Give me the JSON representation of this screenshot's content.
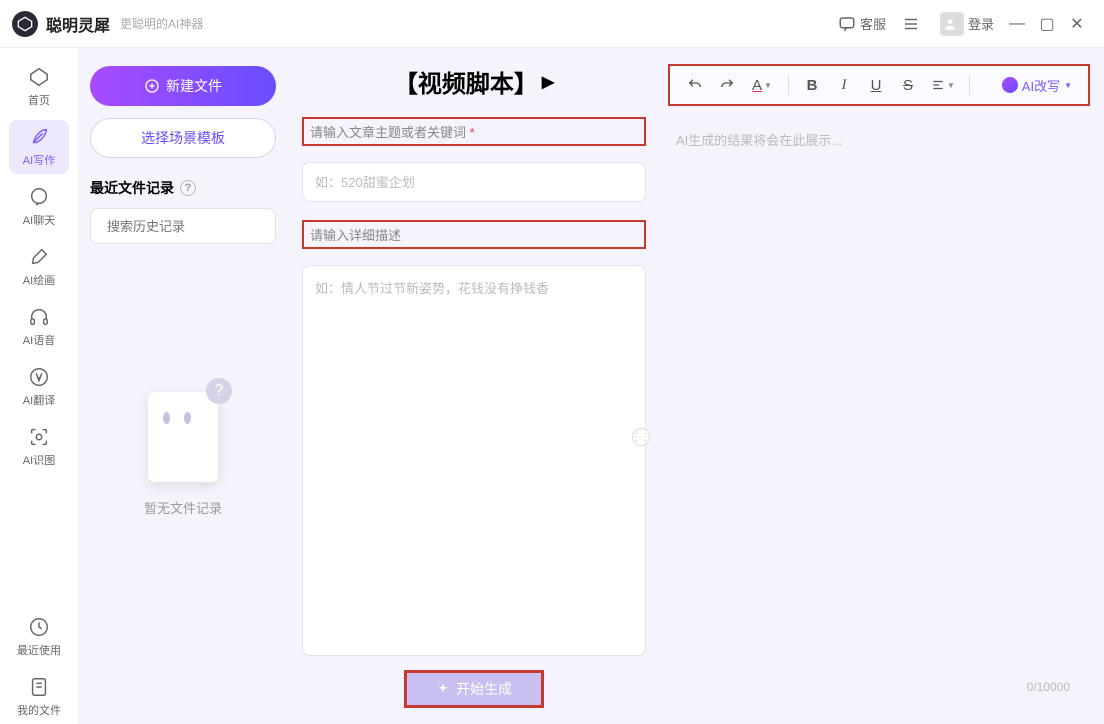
{
  "titlebar": {
    "app_name": "聪明灵犀",
    "slogan": "更聪明的AI神器",
    "support": "客服",
    "login": "登录"
  },
  "sidebar": {
    "items": [
      {
        "label": "首页"
      },
      {
        "label": "AI写作"
      },
      {
        "label": "AI聊天"
      },
      {
        "label": "AI绘画"
      },
      {
        "label": "AI语音"
      },
      {
        "label": "AI翻译"
      },
      {
        "label": "AI识图"
      }
    ],
    "bottom": [
      {
        "label": "最近使用"
      },
      {
        "label": "我的文件"
      }
    ]
  },
  "left": {
    "new_file": "新建文件",
    "choose_template": "选择场景模板",
    "recent_header": "最近文件记录",
    "search_placeholder": "搜索历史记录",
    "empty_text": "暂无文件记录"
  },
  "mid": {
    "title": "【视频脚本】",
    "label_topic": "请输入文章主题或者关键词",
    "topic_placeholder": "如：520甜蜜企划",
    "label_detail": "请输入详细描述",
    "detail_placeholder": "如：情人节过节新姿势，花钱没有挣钱香",
    "generate": "开始生成"
  },
  "right": {
    "ai_rewrite": "AI改写",
    "result_placeholder": "AI生成的结果将会在此展示...",
    "counter": "0/10000"
  }
}
